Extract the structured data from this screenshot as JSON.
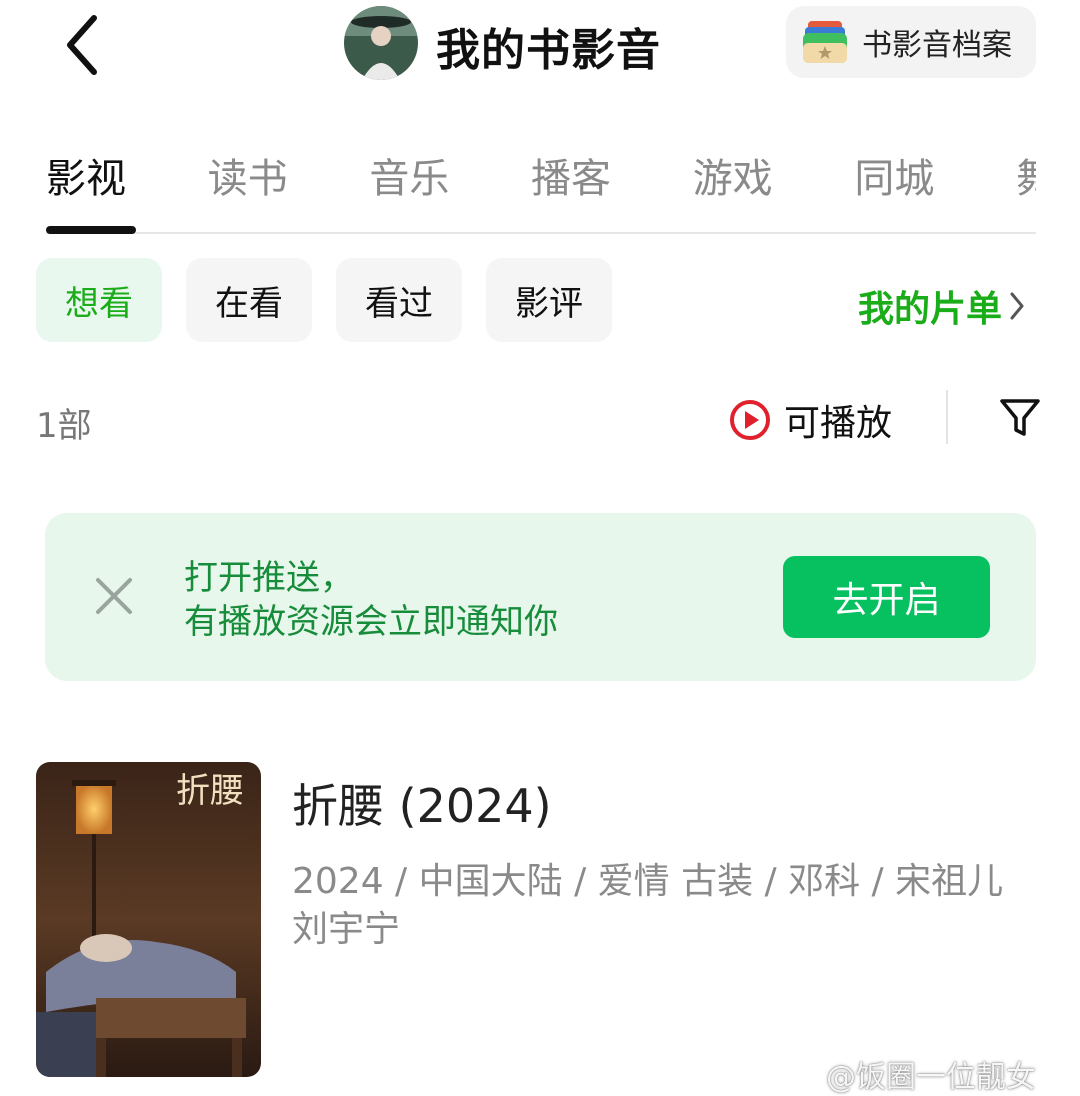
{
  "header": {
    "title": "我的书影音",
    "archive_button_label": "书影音档案"
  },
  "tabs": [
    {
      "label": "影视",
      "active": true
    },
    {
      "label": "读书",
      "active": false
    },
    {
      "label": "音乐",
      "active": false
    },
    {
      "label": "播客",
      "active": false
    },
    {
      "label": "游戏",
      "active": false
    },
    {
      "label": "同城",
      "active": false
    },
    {
      "label": "舞",
      "active": false
    }
  ],
  "filters": {
    "chips": [
      {
        "label": "想看",
        "active": true
      },
      {
        "label": "在看",
        "active": false
      },
      {
        "label": "看过",
        "active": false
      },
      {
        "label": "影评",
        "active": false
      }
    ],
    "my_list_label": "我的片单"
  },
  "count_row": {
    "count": "1部",
    "playable_label": "可播放"
  },
  "banner": {
    "line1": "打开推送，",
    "line2": "有播放资源会立即通知你",
    "button_label": "去开启"
  },
  "movie": {
    "title": "折腰 (2024)",
    "meta": "2024 / 中国大陆 / 爱情 古装 / 邓科 / 宋祖儿 刘宇宁"
  },
  "watermark": "@饭圈一位靓女",
  "colors": {
    "accent_green": "#07c160",
    "text_green": "#1aad19",
    "banner_bg": "#e8f7ec",
    "play_red": "#e0202b"
  }
}
